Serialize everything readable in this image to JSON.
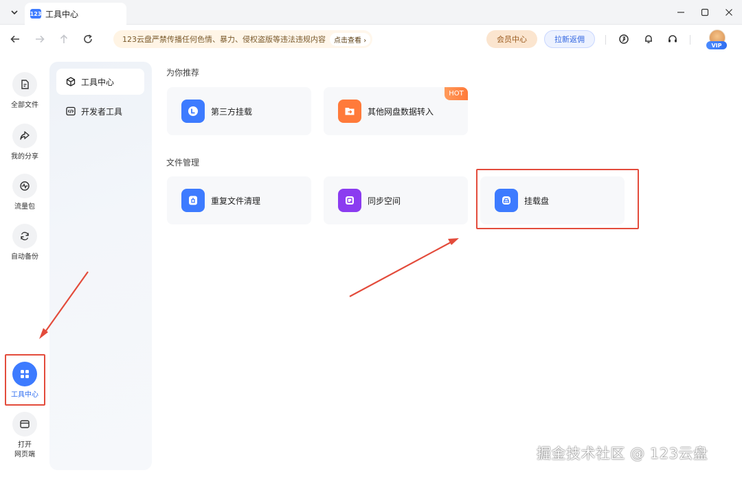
{
  "window": {
    "tab_title": "工具中心",
    "tab_logo": "123",
    "controls": [
      "minimize-icon",
      "maximize-icon",
      "close-icon"
    ]
  },
  "toolbar": {
    "notice_text": "123云盘严禁传播任何色情、暴力、侵权盗版等违法违规内容",
    "notice_link": "点击查看",
    "member_button": "会员中心",
    "invite_button": "拉新返佣",
    "icons": [
      "speed-icon",
      "bell-icon",
      "headset-icon"
    ],
    "vip_badge": "VIP"
  },
  "rail": {
    "items": [
      {
        "label": "全部文件",
        "icon": "file-icon"
      },
      {
        "label": "我的分享",
        "icon": "share-icon"
      },
      {
        "label": "流量包",
        "icon": "traffic-icon"
      },
      {
        "label": "自动备份",
        "icon": "sync-icon"
      },
      {
        "label": "工具中心",
        "icon": "grid-icon",
        "active": true
      },
      {
        "label": "打开\n网页端",
        "icon": "browser-icon"
      }
    ]
  },
  "subnav": {
    "items": [
      {
        "label": "工具中心",
        "icon": "cube-icon",
        "active": true
      },
      {
        "label": "开发者工具",
        "icon": "code-icon"
      }
    ]
  },
  "main": {
    "recommend_title": "为你推荐",
    "recommend_cards": [
      {
        "label": "第三方挂载",
        "icon": "mount-icon",
        "color": "#3d7bff"
      },
      {
        "label": "其他网盘数据转入",
        "icon": "import-folder-icon",
        "color": "#ff7a3a",
        "badge": "HOT"
      }
    ],
    "files_title": "文件管理",
    "file_cards": [
      {
        "label": "重复文件清理",
        "icon": "trash-icon",
        "color": "#3d7bff"
      },
      {
        "label": "同步空间",
        "icon": "sync-space-icon",
        "color": "#8b3cf0"
      },
      {
        "label": "挂载盘",
        "icon": "disk-icon",
        "color": "#3d7bff"
      }
    ]
  },
  "watermark": "掘金技术社区 @ 123云盘",
  "colors": {
    "accent": "#3d7bff",
    "highlight": "#e34b3b",
    "hot": "#ff7a3a",
    "purple": "#8b3cf0"
  }
}
